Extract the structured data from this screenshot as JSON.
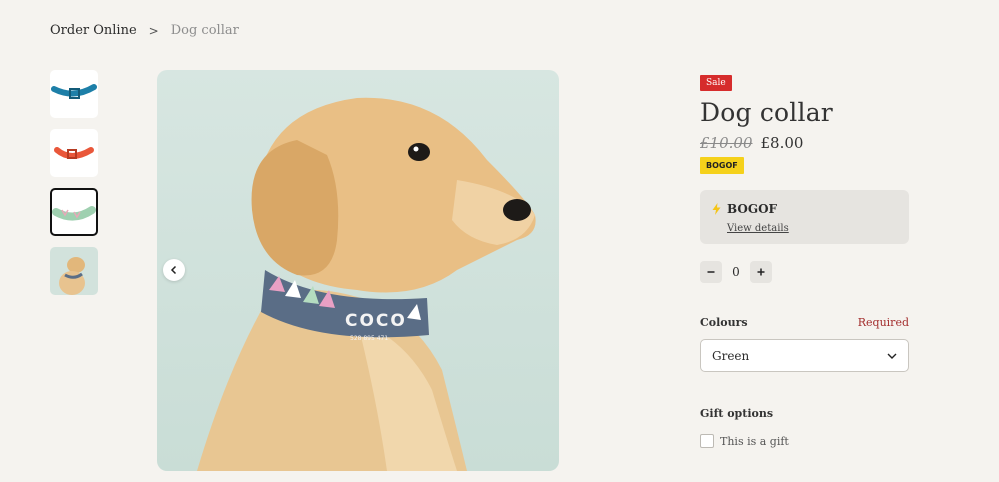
{
  "breadcrumb": {
    "parent": "Order Online",
    "separator": ">",
    "current": "Dog collar"
  },
  "gallery": {
    "thumbnails": [
      {
        "name": "blue collar",
        "selected": false
      },
      {
        "name": "red collar",
        "selected": false
      },
      {
        "name": "mint collar",
        "selected": true
      },
      {
        "name": "dog photo",
        "selected": false
      }
    ],
    "collar_text": "COCO",
    "collar_subtext": "528 895 471"
  },
  "product": {
    "sale_badge": "Sale",
    "title": "Dog collar",
    "old_price": "£10.00",
    "new_price": "£8.00",
    "promo_tag": "BOGOF",
    "promo": {
      "name": "BOGOF",
      "link": "View details"
    },
    "quantity": "0",
    "colours": {
      "label": "Colours",
      "required": "Required",
      "selected": "Green"
    },
    "gift": {
      "label": "Gift options",
      "checkbox_label": "This is a gift",
      "checked": false
    }
  },
  "colors": {
    "sale": "#d62c2c",
    "promo": "#f5d11b",
    "required": "#a32d2d",
    "background": "#f5f3ef"
  }
}
